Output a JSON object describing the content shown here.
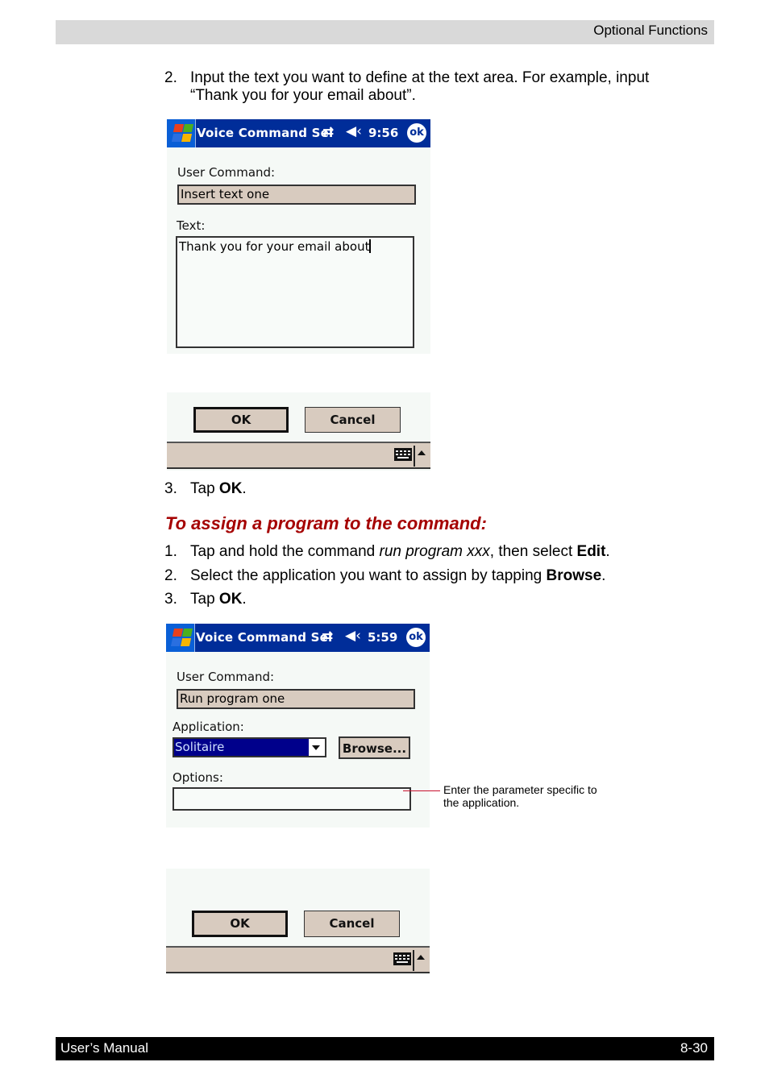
{
  "header": {
    "title": "Optional Functions"
  },
  "footer": {
    "left": "User’s Manual",
    "right": "8-30"
  },
  "steps_top": [
    {
      "num": "2.",
      "line1": "Input the text you want to define at the text area. For example, input",
      "line2": "“Thank you for your email about”."
    }
  ],
  "step_tap_ok_1": {
    "num": "3.",
    "prefix": "Tap ",
    "bold": "OK",
    "suffix": "."
  },
  "section_heading": "To assign a program to the command:",
  "steps_assign": [
    {
      "num": "1.",
      "prefix": "Tap and hold the command ",
      "italic": "run program xxx",
      "middle": ", then select ",
      "bold": "Edit",
      "suffix": "."
    },
    {
      "num": "2.",
      "prefix": "Select the application you want to assign by tapping ",
      "bold": "Browse",
      "suffix": "."
    },
    {
      "num": "3.",
      "prefix": "Tap ",
      "bold": "OK",
      "suffix": "."
    }
  ],
  "screen1": {
    "title": "Voice Command Sel",
    "time": "9:56",
    "ok_label": "ok",
    "user_command_label": "User Command:",
    "user_command_value": "Insert text one",
    "text_label": "Text:",
    "text_value": "Thank you for your email about",
    "ok_button": "OK",
    "cancel_button": "Cancel",
    "icons": {
      "sync": "⇄",
      "volume": "◀"
    }
  },
  "screen2": {
    "title": "Voice Command Sel",
    "time": "5:59",
    "ok_label": "ok",
    "user_command_label": "User Command:",
    "user_command_value": "Run program one",
    "application_label": "Application:",
    "application_value": "Solitaire",
    "browse_button": "Browse...",
    "options_label": "Options:",
    "options_value": "",
    "ok_button": "OK",
    "cancel_button": "Cancel"
  },
  "callout": {
    "line1": "Enter the parameter specific to",
    "line2": "the application."
  },
  "colors": {
    "heading": "#a50000",
    "titlebar": "#002d99",
    "selection": "#00008b",
    "field_bg": "#d8cbbf",
    "callout_line": "#c8102e"
  }
}
